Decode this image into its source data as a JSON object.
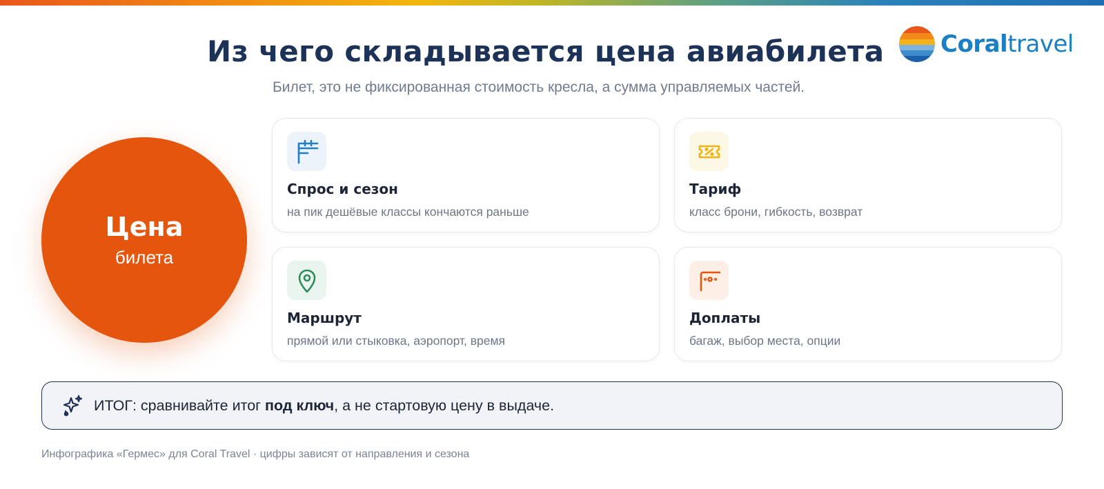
{
  "header": {
    "title": "Из чего складывается цена авиабилета",
    "subtitle": "Билет, это не фиксированная стоимость кресла, а сумма управляемых частей."
  },
  "logo": {
    "brand_bold": "Coral",
    "brand_light": "travel",
    "icon": "coral-sunset-logo-icon"
  },
  "price_circle": {
    "big": "Цена",
    "small": "билета",
    "color": "#e4560d"
  },
  "cards": [
    {
      "title": "Спрос и сезон",
      "desc": "на пик дешёвые классы кончаются раньше",
      "icon": "calendar-icon",
      "color": "#1f7fc0",
      "bg": "#ecf3fa"
    },
    {
      "title": "Тариф",
      "desc": "класс брони, гибкость, возврат",
      "icon": "ticket-percent-icon",
      "color": "#f0b315",
      "bg": "#fdf7e6"
    },
    {
      "title": "Маршрут",
      "desc": "прямой или стыковка, аэропорт, время",
      "icon": "map-pin-icon",
      "color": "#2c8c5b",
      "bg": "#eaf4ee"
    },
    {
      "title": "Доплаты",
      "desc": "багаж, выбор места, опции",
      "icon": "seat-options-icon",
      "color": "#e4560d",
      "bg": "#fdeee6"
    }
  ],
  "summary": {
    "icon": "sparkles-icon",
    "prefix": "ИТОГ: сравнивайте итог ",
    "bold": "под ключ",
    "suffix": ", а не стартовую цену в выдаче."
  },
  "footer": {
    "text": "Инфографика «Гермес» для Coral Travel · цифры зависят от направления и сезона"
  }
}
